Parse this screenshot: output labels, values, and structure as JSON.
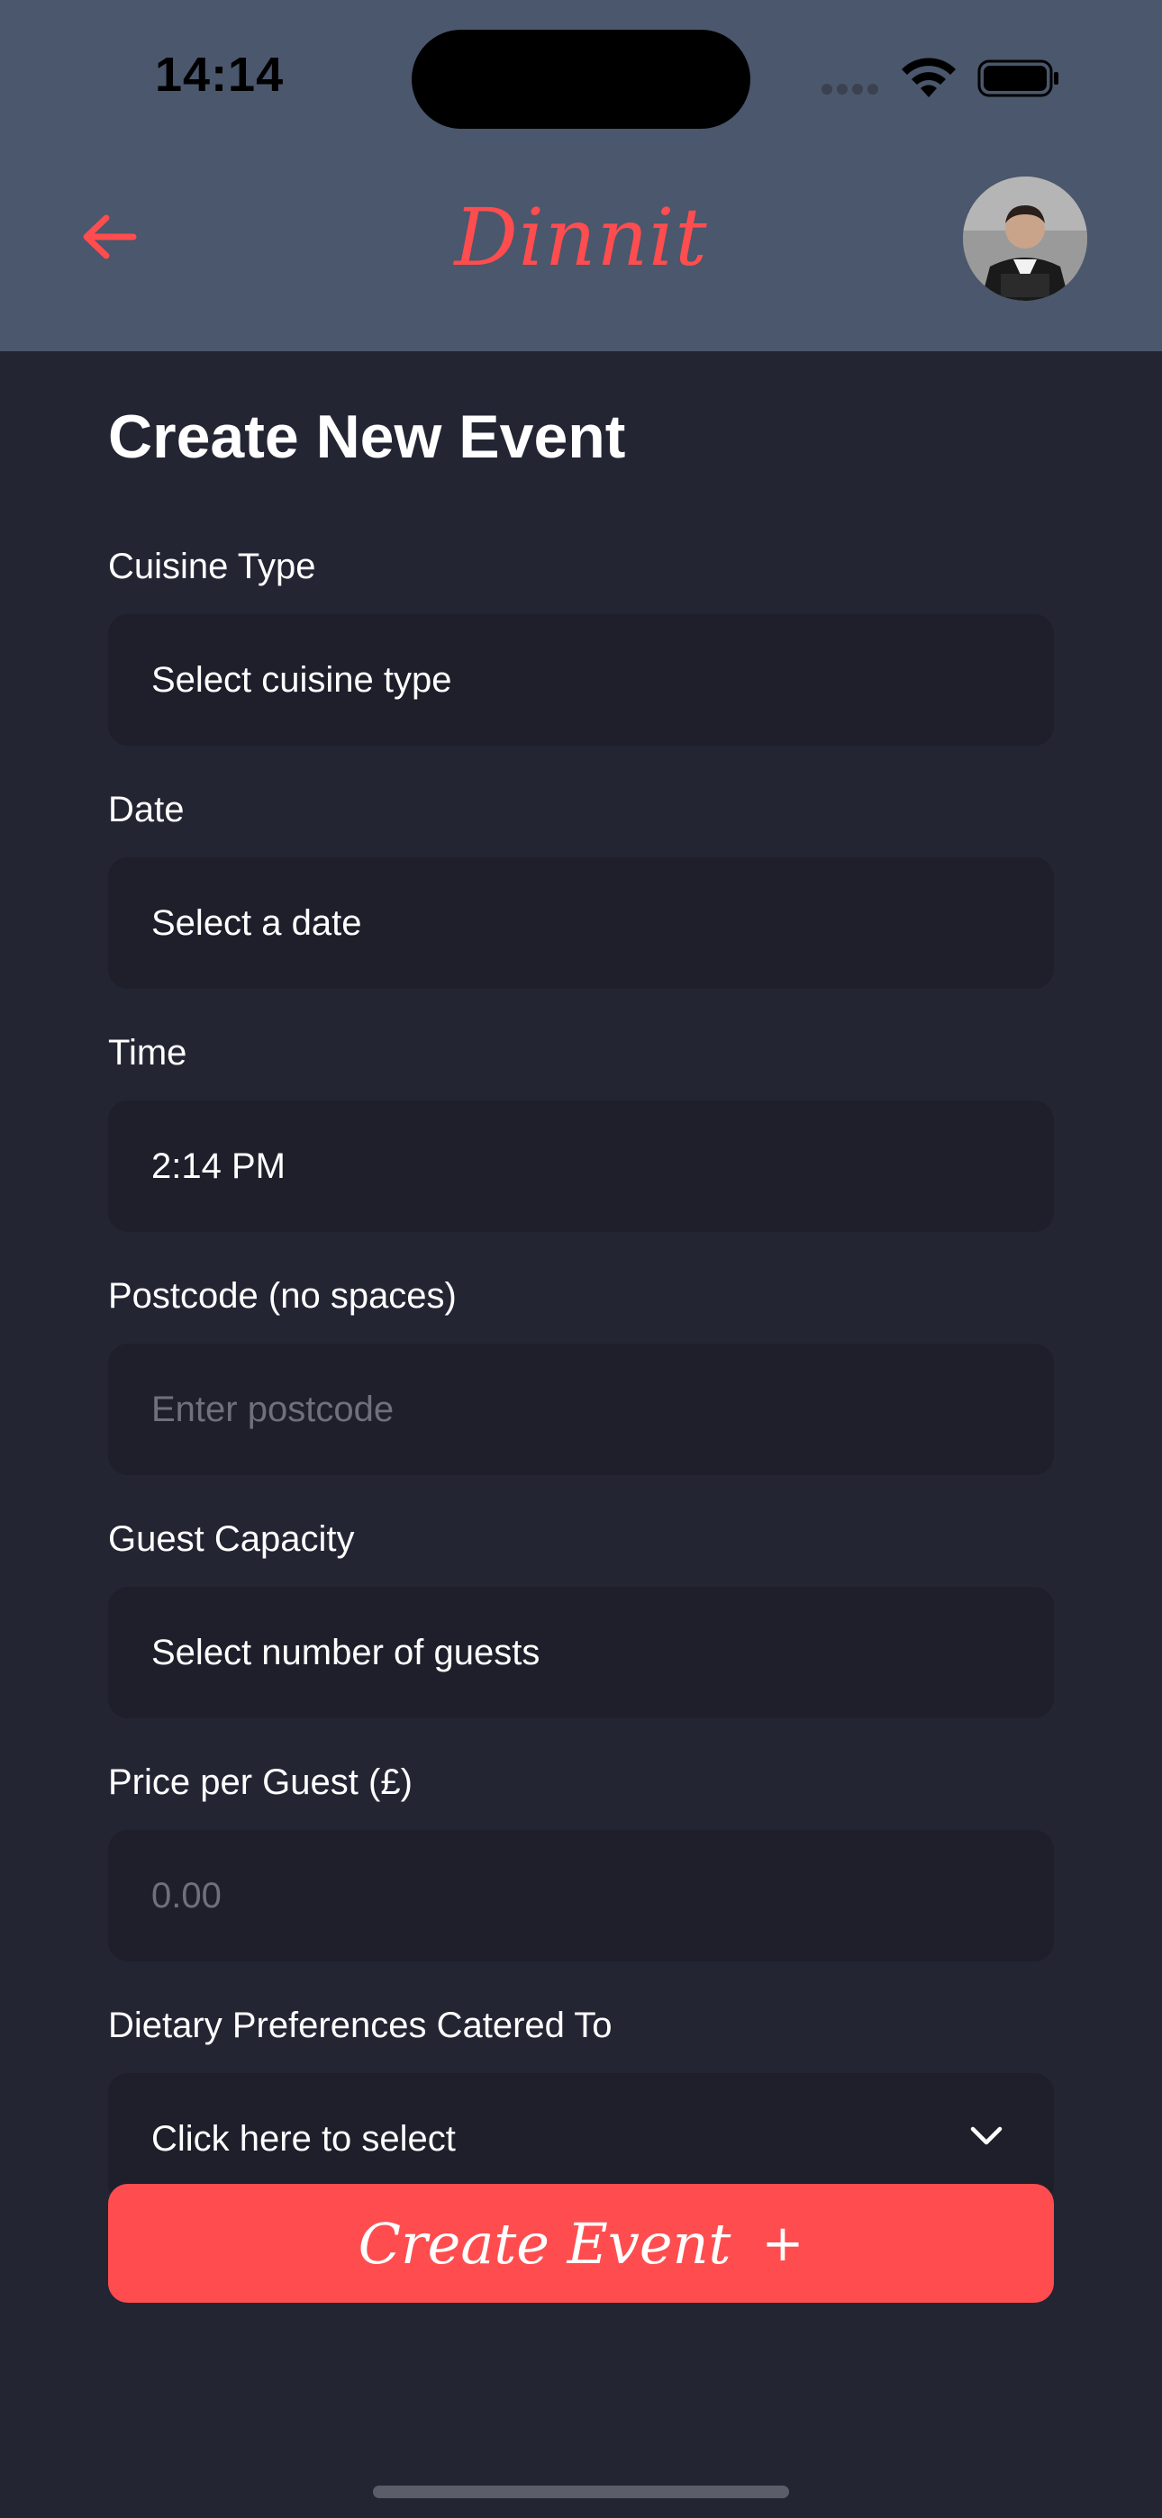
{
  "status_bar": {
    "time": "14:14",
    "icons": [
      "cellular-signal-icon",
      "wifi-icon",
      "battery-icon"
    ]
  },
  "header": {
    "back_icon": "arrow-left-icon",
    "logo_text": "Dinnit",
    "avatar_icon": "user-avatar"
  },
  "page": {
    "title": "Create New Event"
  },
  "form": {
    "cuisine": {
      "label": "Cuisine Type",
      "value": "Select cuisine type"
    },
    "date": {
      "label": "Date",
      "value": "Select a date"
    },
    "time": {
      "label": "Time",
      "value": "2:14 PM"
    },
    "postcode": {
      "label": "Postcode (no spaces)",
      "placeholder": "Enter postcode"
    },
    "guests": {
      "label": "Guest Capacity",
      "value": "Select number of guests"
    },
    "price": {
      "label": "Price per Guest (£)",
      "placeholder": "0.00"
    },
    "dietary": {
      "label": "Dietary Preferences Catered To",
      "value": "Click here to select",
      "icon": "chevron-down-icon"
    }
  },
  "actions": {
    "create_label": "Create Event",
    "create_icon": "+"
  },
  "colors": {
    "accent": "#ff4d4f",
    "header_bg": "#4a576c",
    "page_bg": "#232533",
    "field_bg": "#1e1f2b"
  }
}
